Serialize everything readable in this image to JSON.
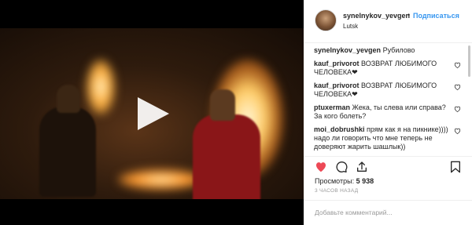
{
  "post": {
    "username": "synelnykov_yevgen",
    "separator": "•",
    "follow_label": "Подписаться",
    "location": "Lutsk"
  },
  "caption": {
    "username": "synelnykov_yevgen",
    "text": "Рубилово"
  },
  "comments": [
    {
      "username": "kauf_privorot",
      "text": "ВОЗВРАТ ЛЮБИМОГО ЧЕЛОВЕКА❤"
    },
    {
      "username": "kauf_privorot",
      "text": "ВОЗВРАТ ЛЮБИМОГО ЧЕЛОВЕКА❤"
    },
    {
      "username": "ptuxerman",
      "text": "Жека, ты слева или справа? За кого болеть?"
    },
    {
      "username": "moi_dobrushki",
      "text": "прям как я на пикнике)))) надо ли говорить что мне теперь не доверяют жарить шашлык))"
    }
  ],
  "stats": {
    "views_label": "Просмотры:",
    "views_count": "5 938",
    "time_ago": "3 ЧАСОВ НАЗАД"
  },
  "comment_box": {
    "placeholder": "Добавьте комментарий..."
  },
  "icons": {
    "like": "heart-filled-icon",
    "comment": "speech-bubble-icon",
    "share": "share-icon",
    "save": "bookmark-icon",
    "play": "play-icon"
  },
  "colors": {
    "like_red": "#ed4956",
    "follow_blue": "#3897f0"
  }
}
